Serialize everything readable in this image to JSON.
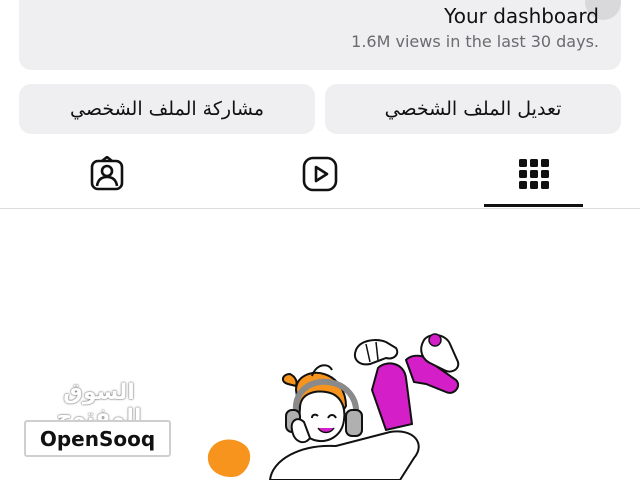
{
  "dashboard": {
    "title": "Your dashboard",
    "subtitle": "1.6M views in the last 30 days."
  },
  "actions": {
    "edit_profile": "تعديل الملف الشخصي",
    "share_profile": "مشاركة الملف الشخصي"
  },
  "tabs": [
    {
      "icon": "grid-icon",
      "active": true
    },
    {
      "icon": "reels-icon",
      "active": false
    },
    {
      "icon": "tagged-icon",
      "active": false
    }
  ],
  "colors": {
    "accent_orange": "#f7941e",
    "accent_magenta": "#d41fc8",
    "card_bg": "#efeff1"
  },
  "watermark": {
    "arabic": "السوق المفتوح",
    "latin": "OpenSooq"
  }
}
